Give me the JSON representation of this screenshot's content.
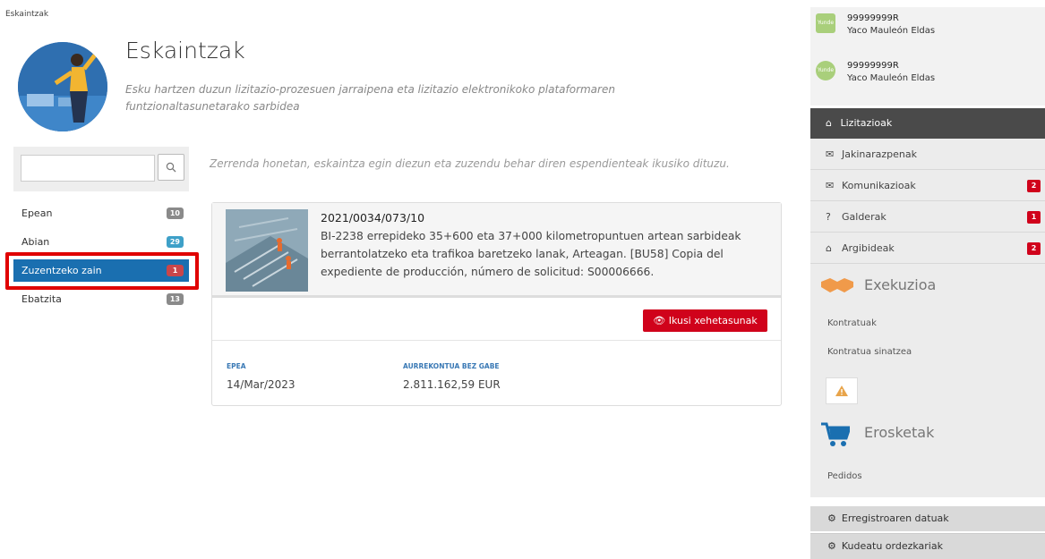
{
  "breadcrumb": "Eskaintzak",
  "hero": {
    "title": "Eskaintzak",
    "description": "Esku hartzen duzun lizitazio-prozesuen jarraipena eta lizitazio elektronikoko plataformaren funtzionaltasunetarako sarbidea"
  },
  "search": {
    "placeholder": ""
  },
  "statuses": [
    {
      "label": "Epean",
      "count": "10",
      "color": "#8a8a8a"
    },
    {
      "label": "Abian",
      "count": "29",
      "color": "#3ea0c8"
    },
    {
      "label": "Zuzentzeko zain",
      "count": "1",
      "color": "#c9464a"
    },
    {
      "label": "Ebatzita",
      "count": "13",
      "color": "#8a8a8a"
    }
  ],
  "intro": "Zerrenda honetan, eskaintza egin diezun eta zuzendu behar diren espendienteak ikusiko dituzu.",
  "card": {
    "code": "2021/0034/073/10",
    "text": "BI-2238 errepideko 35+600 eta 37+000 kilometropuntuen artean sarbideak berrantolatzeko eta trafikoa baretzeko lanak, Arteagan. [BU58] Copia del expediente de producción, número de solicitud: S00006666.",
    "button": "Ikusi xehetasunak",
    "meta": [
      {
        "label": "EPEA",
        "value": "14/Mar/2023"
      },
      {
        "label": "AURREKONTUA BEZ GABE",
        "value": "2.811.162,59 EUR"
      }
    ]
  },
  "users": [
    {
      "avatar": "Yunde",
      "id": "99999999R",
      "name": "Yaco Mauleón Eldas"
    },
    {
      "avatar": "Yunde",
      "id": "99999999R",
      "name": "Yaco Mauleón Eldas"
    }
  ],
  "menu": {
    "header": "Lizitazioak",
    "items": [
      {
        "label": "Jakinarazpenak",
        "icon": "envelope-icon",
        "badge": ""
      },
      {
        "label": "Komunikazioak",
        "icon": "envelope-icon",
        "badge": "2"
      },
      {
        "label": "Galderak",
        "icon": "question-icon",
        "badge": "1"
      },
      {
        "label": "Argibideak",
        "icon": "inbox-icon",
        "badge": "2"
      }
    ]
  },
  "execution": {
    "title": "Exekuzioa",
    "items": [
      "Kontratuak",
      "Kontratua sinatzea"
    ]
  },
  "purchases": {
    "title": "Erosketak",
    "items": [
      "Pedidos"
    ]
  },
  "footer": [
    {
      "label": "Erregistroaren datuak"
    },
    {
      "label": "Kudeatu ordezkariak"
    }
  ],
  "colors": {
    "accent": "#1a6fb0",
    "danger": "#d0021b",
    "highlight": "#e00000"
  }
}
